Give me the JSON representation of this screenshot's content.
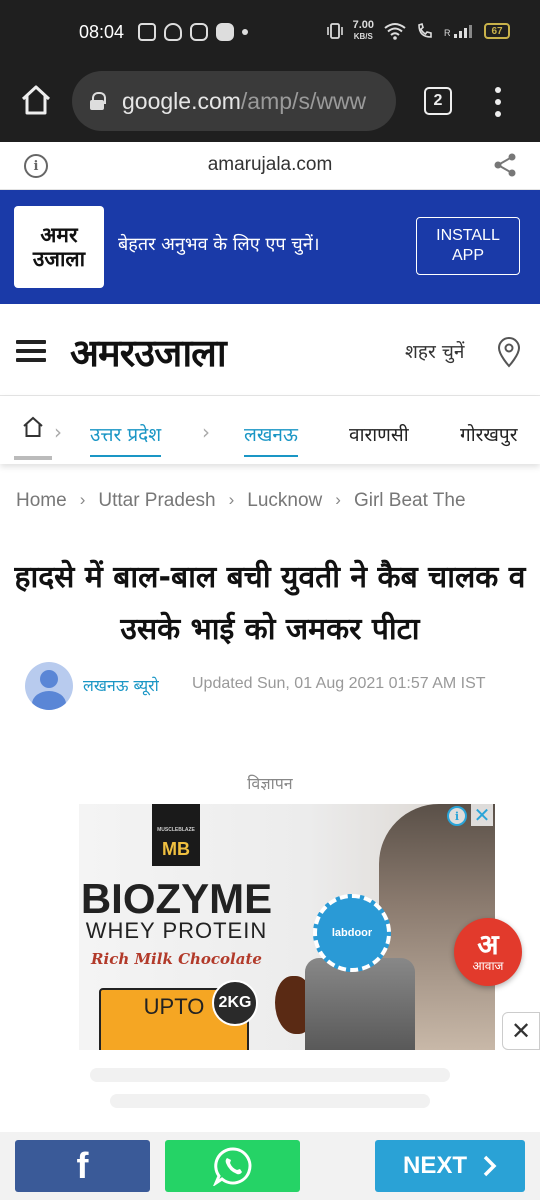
{
  "status_bar": {
    "time": "08:04",
    "net_speed": "7.00",
    "net_unit": "KB/S",
    "battery": "67"
  },
  "browser": {
    "url_host": "google.com",
    "url_path": "/amp/s/www",
    "tab_count": "2"
  },
  "amp_header": {
    "domain": "amarujala.com"
  },
  "install_banner": {
    "logo_line1": "अमर",
    "logo_line2": "उजाला",
    "text": "बेहतर अनुभव के लिए एप चुनें।",
    "button_line1": "INSTALL",
    "button_line2": "APP"
  },
  "site_header": {
    "logo_text": "अमरउजाला",
    "city_select": "शहर चुनें"
  },
  "nav": {
    "items": [
      {
        "label": "उत्तर प्रदेश"
      },
      {
        "label": "लखनऊ"
      },
      {
        "label": "वाराणसी"
      },
      {
        "label": "गोरखपुर"
      }
    ]
  },
  "breadcrumb": {
    "items": [
      "Home",
      "Uttar Pradesh",
      "Lucknow",
      "Girl Beat The"
    ],
    "separator": "›"
  },
  "article": {
    "headline": "हादसे में बाल-बाल बची युवती ने कैब चालक व उसके भाई को जमकर पीटा",
    "author": "लखनऊ ब्यूरो",
    "updated": "Updated Sun, 01 Aug 2021 01:57 AM IST"
  },
  "ad": {
    "label": "विज्ञापन",
    "logo": "MB",
    "brand": "BIOZYME",
    "product": "WHEY PROTEIN",
    "flavor": "Rich Milk Chocolate",
    "offer": "UPTO",
    "weight": "2KG",
    "seal": "labdoor"
  },
  "awaz_badge": {
    "big": "अ",
    "small": "आवाज"
  },
  "share_bar": {
    "facebook": "f",
    "next": "NEXT"
  }
}
